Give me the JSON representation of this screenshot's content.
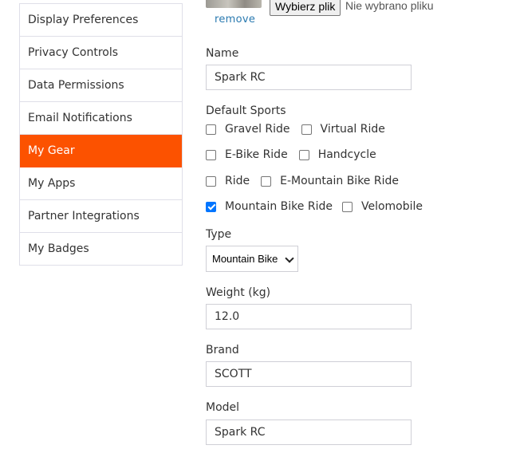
{
  "sidebar": {
    "items": [
      {
        "label": "Display Preferences",
        "active": false
      },
      {
        "label": "Privacy Controls",
        "active": false
      },
      {
        "label": "Data Permissions",
        "active": false
      },
      {
        "label": "Email Notifications",
        "active": false
      },
      {
        "label": "My Gear",
        "active": true
      },
      {
        "label": "My Apps",
        "active": false
      },
      {
        "label": "Partner Integrations",
        "active": false
      },
      {
        "label": "My Badges",
        "active": false
      }
    ],
    "accent_color": "#fc5200"
  },
  "photo": {
    "remove_label": "remove",
    "file_button_label": "Wybierz plik",
    "file_status": "Nie wybrano pliku"
  },
  "form": {
    "name": {
      "label": "Name",
      "value": "Spark RC"
    },
    "default_sports": {
      "label": "Default Sports",
      "options": [
        {
          "label": "Gravel Ride",
          "checked": false
        },
        {
          "label": "Virtual Ride",
          "checked": false
        },
        {
          "label": "E-Bike Ride",
          "checked": false
        },
        {
          "label": "Handcycle",
          "checked": false
        },
        {
          "label": "Ride",
          "checked": false
        },
        {
          "label": "E-Mountain Bike Ride",
          "checked": false
        },
        {
          "label": "Mountain Bike Ride",
          "checked": true
        },
        {
          "label": "Velomobile",
          "checked": false
        }
      ]
    },
    "type": {
      "label": "Type",
      "selected": "Mountain Bike"
    },
    "weight": {
      "label": "Weight (kg)",
      "value": "12.0"
    },
    "brand": {
      "label": "Brand",
      "value": "SCOTT"
    },
    "model": {
      "label": "Model",
      "value": "Spark RC"
    }
  }
}
